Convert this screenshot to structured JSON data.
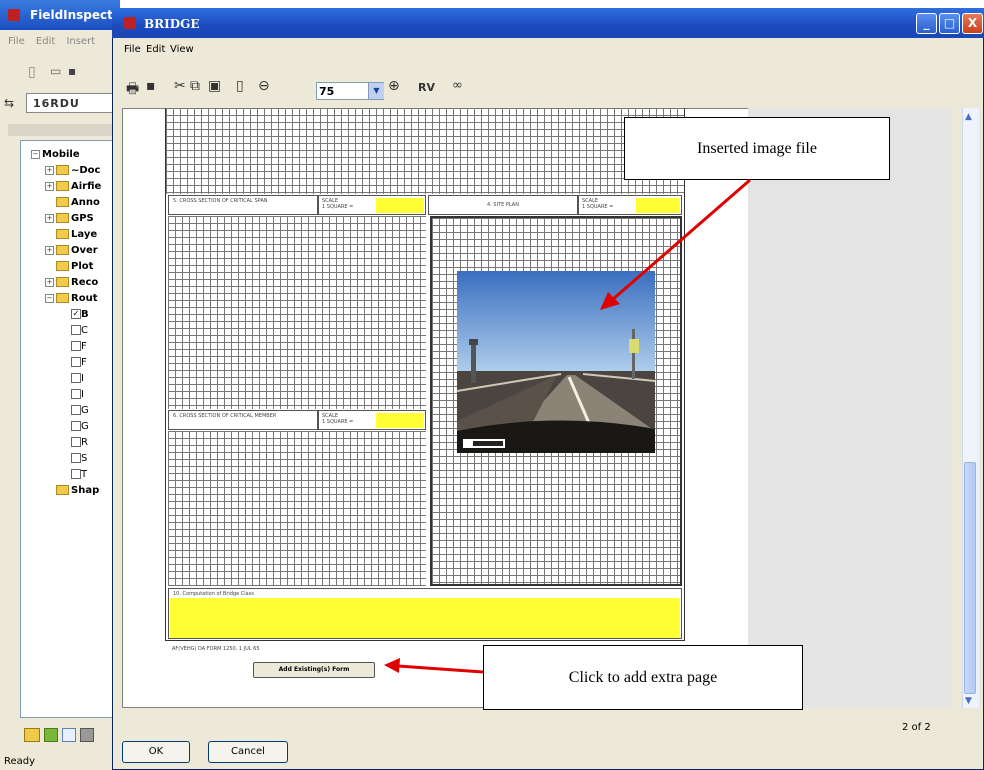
{
  "back_window": {
    "title": "FieldInspect",
    "menu": [
      "File",
      "Edit",
      "Insert"
    ],
    "route_field": "16RDU",
    "tree": {
      "root": "Mobile",
      "items": [
        "~Doc",
        "Airfie",
        "Anno",
        "GPS",
        "Laye",
        "Over",
        "Plot",
        "Reco",
        "Rout",
        "Shap"
      ],
      "checkbox_letters": [
        "B",
        "C",
        "F",
        "F",
        "I",
        "I",
        "G",
        "G",
        "R",
        "S",
        "T"
      ]
    },
    "status": "Ready"
  },
  "window": {
    "title": "BRIDGE",
    "controls": {
      "minimize": "_",
      "maximize": "□",
      "close": "X"
    }
  },
  "menu": {
    "file": "File",
    "edit": "Edit",
    "view": "View"
  },
  "toolbar": {
    "zoom_value": "75",
    "rv_label": "RV",
    "link_label": "∞"
  },
  "form": {
    "section_top_left": "5.  CROSS SECTION OF CRITICAL SPAN",
    "section_bottom_left": "6.  CROSS SECTION OF CRITICAL MEMBER",
    "section_right": "4.  SITE PLAN",
    "scale_label": "SCALE",
    "scale_value": "1 SQUARE =",
    "comment_label": "10. Computation of Bridge Class",
    "footer": "AF(VEHG) DA FORM 1250, 1 JUL 65"
  },
  "add_button_label": "Add Existing(s) Form",
  "callouts": {
    "inserted_image": "Inserted image file",
    "add_page": "Click to add extra page"
  },
  "page_indicator": "2 of 2",
  "buttons": {
    "ok": "OK",
    "cancel": "Cancel"
  },
  "colors": {
    "title_bar": "#1c4bbf",
    "form_highlight": "#ffff33",
    "arrow": "#e00000"
  }
}
